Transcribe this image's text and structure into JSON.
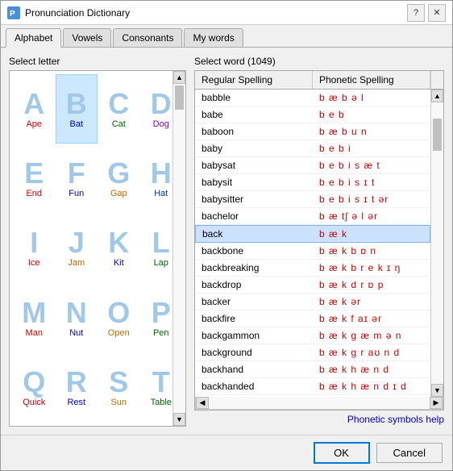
{
  "window": {
    "title": "Pronunciation Dictionary",
    "help_btn": "?",
    "close_btn": "✕"
  },
  "tabs": [
    {
      "id": "alphabet",
      "label": "Alphabet",
      "active": true
    },
    {
      "id": "vowels",
      "label": "Vowels",
      "active": false
    },
    {
      "id": "consonants",
      "label": "Consonants",
      "active": false
    },
    {
      "id": "mywords",
      "label": "My words",
      "active": false
    }
  ],
  "left_panel": {
    "label": "Select letter",
    "letters": [
      {
        "letter": "A",
        "word": "Ape",
        "color": "word-red"
      },
      {
        "letter": "B",
        "word": "Bat",
        "color": "word-blue",
        "selected": true
      },
      {
        "letter": "C",
        "word": "Cat",
        "color": "word-green"
      },
      {
        "letter": "D",
        "word": "Dog",
        "color": "word-purple"
      },
      {
        "letter": "E",
        "word": "End",
        "color": "word-red"
      },
      {
        "letter": "F",
        "word": "Fun",
        "color": "word-blue"
      },
      {
        "letter": "G",
        "word": "Gap",
        "color": "word-orange"
      },
      {
        "letter": "H",
        "word": "Hat",
        "color": "word-darkblue"
      },
      {
        "letter": "I",
        "word": "Ice",
        "color": "word-red"
      },
      {
        "letter": "J",
        "word": "Jam",
        "color": "word-orange"
      },
      {
        "letter": "K",
        "word": "Kit",
        "color": "word-blue"
      },
      {
        "letter": "L",
        "word": "Lap",
        "color": "word-green"
      },
      {
        "letter": "M",
        "word": "Man",
        "color": "word-red"
      },
      {
        "letter": "N",
        "word": "Nut",
        "color": "word-blue"
      },
      {
        "letter": "O",
        "word": "Open",
        "color": "word-orange"
      },
      {
        "letter": "P",
        "word": "Pen",
        "color": "word-green"
      },
      {
        "letter": "Q",
        "word": "Quick",
        "color": "word-red"
      },
      {
        "letter": "R",
        "word": "Rest",
        "color": "word-blue"
      },
      {
        "letter": "S",
        "word": "Sun",
        "color": "word-orange"
      },
      {
        "letter": "T",
        "word": "Table",
        "color": "word-green"
      }
    ]
  },
  "right_panel": {
    "label": "Select word (1049)",
    "columns": [
      "Regular Spelling",
      "Phonetic Spelling"
    ],
    "rows": [
      {
        "regular": "babble",
        "phonetic": "b æ b ə l"
      },
      {
        "regular": "babe",
        "phonetic": "b e b"
      },
      {
        "regular": "baboon",
        "phonetic": "b æ b u n"
      },
      {
        "regular": "baby",
        "phonetic": "b e b i"
      },
      {
        "regular": "babysat",
        "phonetic": "b e b i s æ t"
      },
      {
        "regular": "babysit",
        "phonetic": "b e b i s ɪ t"
      },
      {
        "regular": "babysitter",
        "phonetic": "b e b i s ɪ t ər"
      },
      {
        "regular": "bachelor",
        "phonetic": "b æ tʃ ə l ər"
      },
      {
        "regular": "back",
        "phonetic": "b æ k",
        "selected": true
      },
      {
        "regular": "backbone",
        "phonetic": "b æ k b ɒ n"
      },
      {
        "regular": "backbreaking",
        "phonetic": "b æ k b r e k ɪ ŋ"
      },
      {
        "regular": "backdrop",
        "phonetic": "b æ k d r ɒ p"
      },
      {
        "regular": "backer",
        "phonetic": "b æ k ər"
      },
      {
        "regular": "backfire",
        "phonetic": "b æ k f aɪ ər"
      },
      {
        "regular": "backgammon",
        "phonetic": "b æ k g æ m ə n"
      },
      {
        "regular": "background",
        "phonetic": "b æ k g r aʊ n d"
      },
      {
        "regular": "backhand",
        "phonetic": "b æ k h æ n d"
      },
      {
        "regular": "backhanded",
        "phonetic": "b æ k h æ n d ɪ d"
      }
    ],
    "phonetic_help": "Phonetic symbols help"
  },
  "footer": {
    "ok_label": "OK",
    "cancel_label": "Cancel"
  }
}
